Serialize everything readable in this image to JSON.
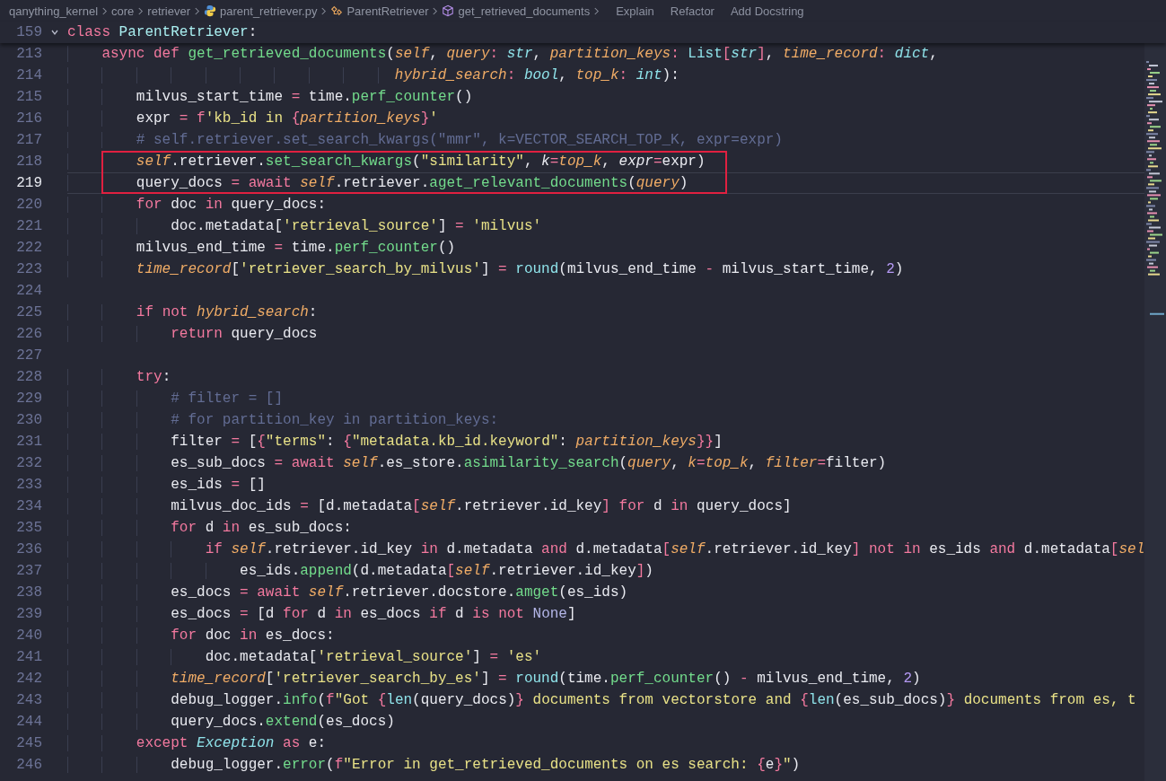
{
  "breadcrumbs": [
    {
      "kind": "folder",
      "label": "qanything_kernel"
    },
    {
      "kind": "folder",
      "label": "core"
    },
    {
      "kind": "folder",
      "label": "retriever"
    },
    {
      "kind": "python-file",
      "label": "parent_retriever.py"
    },
    {
      "kind": "class",
      "label": "ParentRetriever"
    },
    {
      "kind": "method",
      "label": "get_retrieved_documents"
    }
  ],
  "code_lens": [
    "Explain",
    "Refactor",
    "Add Docstring"
  ],
  "sticky_line": {
    "number": "159",
    "expanded": true,
    "tokens": [
      {
        "kind": "kw",
        "text": "class "
      },
      {
        "kind": "classname",
        "text": "ParentRetriever"
      },
      {
        "kind": "plain",
        "text": ":"
      }
    ]
  },
  "lines": [
    {
      "number": "213",
      "boxed": false,
      "current": false,
      "tokens": [
        {
          "kind": "kw",
          "text": "    async "
        },
        {
          "kind": "kw",
          "text": "def "
        },
        {
          "kind": "fn",
          "text": "get_retrieved_documents"
        },
        {
          "kind": "plain",
          "text": "("
        },
        {
          "kind": "self",
          "text": "self"
        },
        {
          "kind": "plain",
          "text": ", "
        },
        {
          "kind": "param",
          "text": "query"
        },
        {
          "kind": "op",
          "text": ": "
        },
        {
          "kind": "type",
          "text": "str"
        },
        {
          "kind": "plain",
          "text": ", "
        },
        {
          "kind": "param",
          "text": "partition_keys"
        },
        {
          "kind": "op",
          "text": ": "
        },
        {
          "kind": "builtin",
          "text": "List"
        },
        {
          "kind": "op",
          "text": "["
        },
        {
          "kind": "type",
          "text": "str"
        },
        {
          "kind": "op",
          "text": "]"
        },
        {
          "kind": "plain",
          "text": ", "
        },
        {
          "kind": "param",
          "text": "time_record"
        },
        {
          "kind": "op",
          "text": ": "
        },
        {
          "kind": "type",
          "text": "dict"
        },
        {
          "kind": "plain",
          "text": ","
        }
      ]
    },
    {
      "number": "214",
      "boxed": false,
      "current": false,
      "tokens": [
        {
          "kind": "param",
          "text": "                                      hybrid_search"
        },
        {
          "kind": "op",
          "text": ": "
        },
        {
          "kind": "type",
          "text": "bool"
        },
        {
          "kind": "plain",
          "text": ", "
        },
        {
          "kind": "param",
          "text": "top_k"
        },
        {
          "kind": "op",
          "text": ": "
        },
        {
          "kind": "type",
          "text": "int"
        },
        {
          "kind": "plain",
          "text": "):"
        }
      ]
    },
    {
      "number": "215",
      "boxed": false,
      "current": false,
      "tokens": [
        {
          "kind": "plain",
          "text": "        milvus_start_time "
        },
        {
          "kind": "op",
          "text": "="
        },
        {
          "kind": "plain",
          "text": " time."
        },
        {
          "kind": "fn",
          "text": "perf_counter"
        },
        {
          "kind": "plain",
          "text": "()"
        }
      ]
    },
    {
      "number": "216",
      "boxed": false,
      "current": false,
      "tokens": [
        {
          "kind": "plain",
          "text": "        expr "
        },
        {
          "kind": "op",
          "text": "= "
        },
        {
          "kind": "kw",
          "text": "f"
        },
        {
          "kind": "str",
          "text": "'kb_id in "
        },
        {
          "kind": "op",
          "text": "{"
        },
        {
          "kind": "param",
          "text": "partition_keys"
        },
        {
          "kind": "op",
          "text": "}"
        },
        {
          "kind": "str",
          "text": "'"
        }
      ]
    },
    {
      "number": "217",
      "boxed": false,
      "current": false,
      "tokens": [
        {
          "kind": "cmt",
          "text": "        # self.retriever.set_search_kwargs(\"mmr\", k=VECTOR_SEARCH_TOP_K, expr=expr)"
        }
      ]
    },
    {
      "number": "218",
      "boxed": true,
      "current": false,
      "tokens": [
        {
          "kind": "self",
          "text": "        self"
        },
        {
          "kind": "plain",
          "text": ".retriever."
        },
        {
          "kind": "fn",
          "text": "set_search_kwargs"
        },
        {
          "kind": "plain",
          "text": "("
        },
        {
          "kind": "str",
          "text": "\"similarity\""
        },
        {
          "kind": "plain",
          "text": ", "
        },
        {
          "kind": "kwarg",
          "text": "k"
        },
        {
          "kind": "op",
          "text": "="
        },
        {
          "kind": "param",
          "text": "top_k"
        },
        {
          "kind": "plain",
          "text": ", "
        },
        {
          "kind": "kwarg",
          "text": "expr"
        },
        {
          "kind": "op",
          "text": "="
        },
        {
          "kind": "plain",
          "text": "expr)"
        }
      ]
    },
    {
      "number": "219",
      "boxed": true,
      "current": true,
      "tokens": [
        {
          "kind": "plain",
          "text": "        query_docs "
        },
        {
          "kind": "op",
          "text": "= "
        },
        {
          "kind": "kw",
          "text": "await "
        },
        {
          "kind": "self",
          "text": "self"
        },
        {
          "kind": "plain",
          "text": ".retriever."
        },
        {
          "kind": "fn",
          "text": "aget_relevant_documents"
        },
        {
          "kind": "plain",
          "text": "("
        },
        {
          "kind": "param",
          "text": "query"
        },
        {
          "kind": "plain",
          "text": ")"
        }
      ]
    },
    {
      "number": "220",
      "boxed": false,
      "current": false,
      "tokens": [
        {
          "kind": "kw",
          "text": "        for"
        },
        {
          "kind": "plain",
          "text": " doc "
        },
        {
          "kind": "kw",
          "text": "in"
        },
        {
          "kind": "plain",
          "text": " query_docs:"
        }
      ]
    },
    {
      "number": "221",
      "boxed": false,
      "current": false,
      "tokens": [
        {
          "kind": "plain",
          "text": "            doc.metadata["
        },
        {
          "kind": "str",
          "text": "'retrieval_source'"
        },
        {
          "kind": "plain",
          "text": "] "
        },
        {
          "kind": "op",
          "text": "= "
        },
        {
          "kind": "str",
          "text": "'milvus'"
        }
      ]
    },
    {
      "number": "222",
      "boxed": false,
      "current": false,
      "tokens": [
        {
          "kind": "plain",
          "text": "        milvus_end_time "
        },
        {
          "kind": "op",
          "text": "="
        },
        {
          "kind": "plain",
          "text": " time."
        },
        {
          "kind": "fn",
          "text": "perf_counter"
        },
        {
          "kind": "plain",
          "text": "()"
        }
      ]
    },
    {
      "number": "223",
      "boxed": false,
      "current": false,
      "tokens": [
        {
          "kind": "param",
          "text": "        time_record"
        },
        {
          "kind": "plain",
          "text": "["
        },
        {
          "kind": "str",
          "text": "'retriever_search_by_milvus'"
        },
        {
          "kind": "plain",
          "text": "] "
        },
        {
          "kind": "op",
          "text": "= "
        },
        {
          "kind": "builtin",
          "text": "round"
        },
        {
          "kind": "plain",
          "text": "(milvus_end_time "
        },
        {
          "kind": "op",
          "text": "-"
        },
        {
          "kind": "plain",
          "text": " milvus_start_time, "
        },
        {
          "kind": "num",
          "text": "2"
        },
        {
          "kind": "plain",
          "text": ")"
        }
      ]
    },
    {
      "number": "224",
      "boxed": false,
      "current": false
    },
    {
      "number": "225",
      "boxed": false,
      "current": false,
      "tokens": [
        {
          "kind": "kw",
          "text": "        if "
        },
        {
          "kind": "kw",
          "text": "not "
        },
        {
          "kind": "param",
          "text": "hybrid_search"
        },
        {
          "kind": "plain",
          "text": ":"
        }
      ]
    },
    {
      "number": "226",
      "boxed": false,
      "current": false,
      "tokens": [
        {
          "kind": "kw",
          "text": "            return"
        },
        {
          "kind": "plain",
          "text": " query_docs"
        }
      ]
    },
    {
      "number": "227",
      "boxed": false,
      "current": false
    },
    {
      "number": "228",
      "boxed": false,
      "current": false,
      "tokens": [
        {
          "kind": "kw",
          "text": "        try"
        },
        {
          "kind": "plain",
          "text": ":"
        }
      ]
    },
    {
      "number": "229",
      "boxed": false,
      "current": false,
      "tokens": [
        {
          "kind": "cmt",
          "text": "            # filter = []"
        }
      ]
    },
    {
      "number": "230",
      "boxed": false,
      "current": false,
      "tokens": [
        {
          "kind": "cmt",
          "text": "            # for partition_key in partition_keys:"
        }
      ]
    },
    {
      "number": "231",
      "boxed": false,
      "current": false,
      "tokens": [
        {
          "kind": "plain",
          "text": "            filter "
        },
        {
          "kind": "op",
          "text": "="
        },
        {
          "kind": "plain",
          "text": " ["
        },
        {
          "kind": "op",
          "text": "{"
        },
        {
          "kind": "str",
          "text": "\"terms\""
        },
        {
          "kind": "plain",
          "text": ": "
        },
        {
          "kind": "op",
          "text": "{"
        },
        {
          "kind": "str",
          "text": "\"metadata.kb_id.keyword\""
        },
        {
          "kind": "plain",
          "text": ": "
        },
        {
          "kind": "param",
          "text": "partition_keys"
        },
        {
          "kind": "op",
          "text": "}}"
        },
        {
          "kind": "plain",
          "text": "]"
        }
      ]
    },
    {
      "number": "232",
      "boxed": false,
      "current": false,
      "tokens": [
        {
          "kind": "plain",
          "text": "            es_sub_docs "
        },
        {
          "kind": "op",
          "text": "= "
        },
        {
          "kind": "kw",
          "text": "await "
        },
        {
          "kind": "self",
          "text": "self"
        },
        {
          "kind": "plain",
          "text": ".es_store."
        },
        {
          "kind": "fn",
          "text": "asimilarity_search"
        },
        {
          "kind": "plain",
          "text": "("
        },
        {
          "kind": "param",
          "text": "query"
        },
        {
          "kind": "plain",
          "text": ", "
        },
        {
          "kind": "param",
          "text": "k"
        },
        {
          "kind": "op",
          "text": "="
        },
        {
          "kind": "param",
          "text": "top_k"
        },
        {
          "kind": "plain",
          "text": ", "
        },
        {
          "kind": "param",
          "text": "filter"
        },
        {
          "kind": "op",
          "text": "="
        },
        {
          "kind": "plain",
          "text": "filter)"
        }
      ]
    },
    {
      "number": "233",
      "boxed": false,
      "current": false,
      "tokens": [
        {
          "kind": "plain",
          "text": "            es_ids "
        },
        {
          "kind": "op",
          "text": "="
        },
        {
          "kind": "plain",
          "text": " []"
        }
      ]
    },
    {
      "number": "234",
      "boxed": false,
      "current": false,
      "tokens": [
        {
          "kind": "plain",
          "text": "            milvus_doc_ids "
        },
        {
          "kind": "op",
          "text": "="
        },
        {
          "kind": "plain",
          "text": " [d.metadata"
        },
        {
          "kind": "op",
          "text": "["
        },
        {
          "kind": "self",
          "text": "self"
        },
        {
          "kind": "plain",
          "text": ".retriever.id_key"
        },
        {
          "kind": "op",
          "text": "] "
        },
        {
          "kind": "kw",
          "text": "for"
        },
        {
          "kind": "plain",
          "text": " d "
        },
        {
          "kind": "kw",
          "text": "in"
        },
        {
          "kind": "plain",
          "text": " query_docs]"
        }
      ]
    },
    {
      "number": "235",
      "boxed": false,
      "current": false,
      "tokens": [
        {
          "kind": "kw",
          "text": "            for"
        },
        {
          "kind": "plain",
          "text": " d "
        },
        {
          "kind": "kw",
          "text": "in"
        },
        {
          "kind": "plain",
          "text": " es_sub_docs:"
        }
      ]
    },
    {
      "number": "236",
      "boxed": false,
      "current": false,
      "tokens": [
        {
          "kind": "kw",
          "text": "                if "
        },
        {
          "kind": "self",
          "text": "self"
        },
        {
          "kind": "plain",
          "text": ".retriever.id_key "
        },
        {
          "kind": "kw",
          "text": "in"
        },
        {
          "kind": "plain",
          "text": " d.metadata "
        },
        {
          "kind": "kw",
          "text": "and"
        },
        {
          "kind": "plain",
          "text": " d.metadata"
        },
        {
          "kind": "op",
          "text": "["
        },
        {
          "kind": "self",
          "text": "self"
        },
        {
          "kind": "plain",
          "text": ".retriever.id_key"
        },
        {
          "kind": "op",
          "text": "] "
        },
        {
          "kind": "kw",
          "text": "not "
        },
        {
          "kind": "kw",
          "text": "in"
        },
        {
          "kind": "plain",
          "text": " es_ids "
        },
        {
          "kind": "kw",
          "text": "and"
        },
        {
          "kind": "plain",
          "text": " d.metadata"
        },
        {
          "kind": "op",
          "text": "["
        },
        {
          "kind": "self",
          "text": "sel"
        }
      ]
    },
    {
      "number": "237",
      "boxed": false,
      "current": false,
      "tokens": [
        {
          "kind": "plain",
          "text": "                    es_ids."
        },
        {
          "kind": "fn",
          "text": "append"
        },
        {
          "kind": "plain",
          "text": "(d.metadata"
        },
        {
          "kind": "op",
          "text": "["
        },
        {
          "kind": "self",
          "text": "self"
        },
        {
          "kind": "plain",
          "text": ".retriever.id_key"
        },
        {
          "kind": "op",
          "text": "]"
        },
        {
          "kind": "plain",
          "text": ")"
        }
      ]
    },
    {
      "number": "238",
      "boxed": false,
      "current": false,
      "tokens": [
        {
          "kind": "plain",
          "text": "            es_docs "
        },
        {
          "kind": "op",
          "text": "= "
        },
        {
          "kind": "kw",
          "text": "await "
        },
        {
          "kind": "self",
          "text": "self"
        },
        {
          "kind": "plain",
          "text": ".retriever.docstore."
        },
        {
          "kind": "fn",
          "text": "amget"
        },
        {
          "kind": "plain",
          "text": "(es_ids)"
        }
      ]
    },
    {
      "number": "239",
      "boxed": false,
      "current": false,
      "tokens": [
        {
          "kind": "plain",
          "text": "            es_docs "
        },
        {
          "kind": "op",
          "text": "="
        },
        {
          "kind": "plain",
          "text": " [d "
        },
        {
          "kind": "kw",
          "text": "for"
        },
        {
          "kind": "plain",
          "text": " d "
        },
        {
          "kind": "kw",
          "text": "in"
        },
        {
          "kind": "plain",
          "text": " es_docs "
        },
        {
          "kind": "kw",
          "text": "if"
        },
        {
          "kind": "plain",
          "text": " d "
        },
        {
          "kind": "kw",
          "text": "is "
        },
        {
          "kind": "kw",
          "text": "not "
        },
        {
          "kind": "const",
          "text": "None"
        },
        {
          "kind": "plain",
          "text": "]"
        }
      ]
    },
    {
      "number": "240",
      "boxed": false,
      "current": false,
      "tokens": [
        {
          "kind": "kw",
          "text": "            for"
        },
        {
          "kind": "plain",
          "text": " doc "
        },
        {
          "kind": "kw",
          "text": "in"
        },
        {
          "kind": "plain",
          "text": " es_docs:"
        }
      ]
    },
    {
      "number": "241",
      "boxed": false,
      "current": false,
      "tokens": [
        {
          "kind": "plain",
          "text": "                doc.metadata["
        },
        {
          "kind": "str",
          "text": "'retrieval_source'"
        },
        {
          "kind": "plain",
          "text": "] "
        },
        {
          "kind": "op",
          "text": "= "
        },
        {
          "kind": "str",
          "text": "'es'"
        }
      ]
    },
    {
      "number": "242",
      "boxed": false,
      "current": false,
      "tokens": [
        {
          "kind": "param",
          "text": "            time_record"
        },
        {
          "kind": "plain",
          "text": "["
        },
        {
          "kind": "str",
          "text": "'retriever_search_by_es'"
        },
        {
          "kind": "plain",
          "text": "] "
        },
        {
          "kind": "op",
          "text": "= "
        },
        {
          "kind": "builtin",
          "text": "round"
        },
        {
          "kind": "plain",
          "text": "(time."
        },
        {
          "kind": "fn",
          "text": "perf_counter"
        },
        {
          "kind": "plain",
          "text": "() "
        },
        {
          "kind": "op",
          "text": "-"
        },
        {
          "kind": "plain",
          "text": " milvus_end_time, "
        },
        {
          "kind": "num",
          "text": "2"
        },
        {
          "kind": "plain",
          "text": ")"
        }
      ]
    },
    {
      "number": "243",
      "boxed": false,
      "current": false,
      "tokens": [
        {
          "kind": "plain",
          "text": "            debug_logger."
        },
        {
          "kind": "fn",
          "text": "info"
        },
        {
          "kind": "plain",
          "text": "("
        },
        {
          "kind": "kw",
          "text": "f"
        },
        {
          "kind": "str",
          "text": "\"Got "
        },
        {
          "kind": "op",
          "text": "{"
        },
        {
          "kind": "builtin",
          "text": "len"
        },
        {
          "kind": "plain",
          "text": "(query_docs)"
        },
        {
          "kind": "op",
          "text": "}"
        },
        {
          "kind": "str",
          "text": " documents from vectorstore and "
        },
        {
          "kind": "op",
          "text": "{"
        },
        {
          "kind": "builtin",
          "text": "len"
        },
        {
          "kind": "plain",
          "text": "(es_sub_docs)"
        },
        {
          "kind": "op",
          "text": "}"
        },
        {
          "kind": "str",
          "text": " documents from es, t"
        }
      ]
    },
    {
      "number": "244",
      "boxed": false,
      "current": false,
      "tokens": [
        {
          "kind": "plain",
          "text": "            query_docs."
        },
        {
          "kind": "fn",
          "text": "extend"
        },
        {
          "kind": "plain",
          "text": "(es_docs)"
        }
      ]
    },
    {
      "number": "245",
      "boxed": false,
      "current": false,
      "tokens": [
        {
          "kind": "kw",
          "text": "        except "
        },
        {
          "kind": "type",
          "text": "Exception "
        },
        {
          "kind": "kw",
          "text": "as"
        },
        {
          "kind": "plain",
          "text": " e:"
        }
      ]
    },
    {
      "number": "246",
      "boxed": false,
      "current": false,
      "tokens": [
        {
          "kind": "plain",
          "text": "            debug_logger."
        },
        {
          "kind": "fn",
          "text": "error"
        },
        {
          "kind": "plain",
          "text": "("
        },
        {
          "kind": "kw",
          "text": "f"
        },
        {
          "kind": "str",
          "text": "\"Error in get_retrieved_documents on es search: "
        },
        {
          "kind": "op",
          "text": "{"
        },
        {
          "kind": "plain",
          "text": "e"
        },
        {
          "kind": "op",
          "text": "}"
        },
        {
          "kind": "str",
          "text": "\""
        },
        {
          "kind": "plain",
          "text": ")"
        }
      ]
    }
  ]
}
